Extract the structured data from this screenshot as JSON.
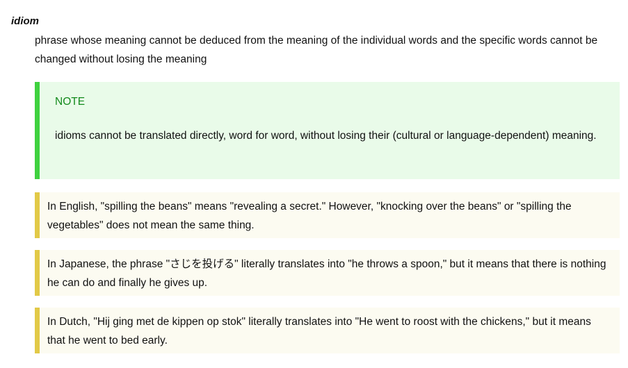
{
  "entry": {
    "term": "idiom",
    "definition": "phrase whose meaning cannot be deduced from the meaning of the individual words and the specific words cannot be changed without losing the meaning"
  },
  "note": {
    "label": "NOTE",
    "text": "idioms cannot be translated directly, word for word, without losing their (cultural or language-dependent) meaning.",
    "accent_color": "#3fd13f",
    "background_color": "#e9fbe9",
    "label_color": "#138a1c"
  },
  "examples": [
    {
      "text": "In English, \"spilling the beans\" means \"revealing a secret.\" However, \"knocking over the beans\" or \"spilling the vegetables\" does not mean the same thing."
    },
    {
      "text": "In Japanese, the phrase \"さじを投げる\" literally translates into \"he throws a spoon,\" but it means that there is nothing he can do and finally he gives up."
    },
    {
      "text": "In Dutch, \"Hij ging met de kippen op stok\" literally translates into \"He went to roost with the chickens,\" but it means that he went to bed early."
    }
  ],
  "example_style": {
    "accent_color": "#e2c947",
    "background_color": "#fcfbf1"
  }
}
